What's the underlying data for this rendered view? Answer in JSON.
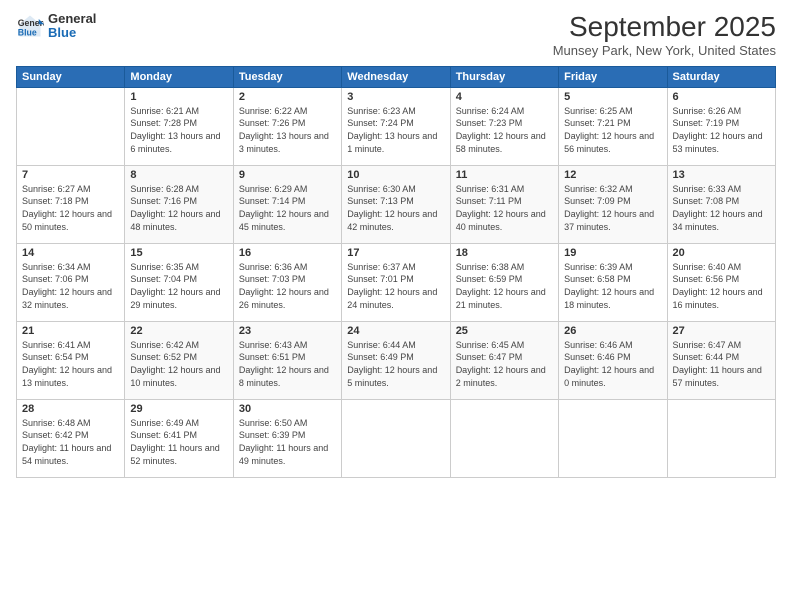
{
  "logo": {
    "line1": "General",
    "line2": "Blue"
  },
  "title": "September 2025",
  "location": "Munsey Park, New York, United States",
  "days_of_week": [
    "Sunday",
    "Monday",
    "Tuesday",
    "Wednesday",
    "Thursday",
    "Friday",
    "Saturday"
  ],
  "weeks": [
    [
      {
        "day": "",
        "sunrise": "",
        "sunset": "",
        "daylight": ""
      },
      {
        "day": "1",
        "sunrise": "Sunrise: 6:21 AM",
        "sunset": "Sunset: 7:28 PM",
        "daylight": "Daylight: 13 hours and 6 minutes."
      },
      {
        "day": "2",
        "sunrise": "Sunrise: 6:22 AM",
        "sunset": "Sunset: 7:26 PM",
        "daylight": "Daylight: 13 hours and 3 minutes."
      },
      {
        "day": "3",
        "sunrise": "Sunrise: 6:23 AM",
        "sunset": "Sunset: 7:24 PM",
        "daylight": "Daylight: 13 hours and 1 minute."
      },
      {
        "day": "4",
        "sunrise": "Sunrise: 6:24 AM",
        "sunset": "Sunset: 7:23 PM",
        "daylight": "Daylight: 12 hours and 58 minutes."
      },
      {
        "day": "5",
        "sunrise": "Sunrise: 6:25 AM",
        "sunset": "Sunset: 7:21 PM",
        "daylight": "Daylight: 12 hours and 56 minutes."
      },
      {
        "day": "6",
        "sunrise": "Sunrise: 6:26 AM",
        "sunset": "Sunset: 7:19 PM",
        "daylight": "Daylight: 12 hours and 53 minutes."
      }
    ],
    [
      {
        "day": "7",
        "sunrise": "Sunrise: 6:27 AM",
        "sunset": "Sunset: 7:18 PM",
        "daylight": "Daylight: 12 hours and 50 minutes."
      },
      {
        "day": "8",
        "sunrise": "Sunrise: 6:28 AM",
        "sunset": "Sunset: 7:16 PM",
        "daylight": "Daylight: 12 hours and 48 minutes."
      },
      {
        "day": "9",
        "sunrise": "Sunrise: 6:29 AM",
        "sunset": "Sunset: 7:14 PM",
        "daylight": "Daylight: 12 hours and 45 minutes."
      },
      {
        "day": "10",
        "sunrise": "Sunrise: 6:30 AM",
        "sunset": "Sunset: 7:13 PM",
        "daylight": "Daylight: 12 hours and 42 minutes."
      },
      {
        "day": "11",
        "sunrise": "Sunrise: 6:31 AM",
        "sunset": "Sunset: 7:11 PM",
        "daylight": "Daylight: 12 hours and 40 minutes."
      },
      {
        "day": "12",
        "sunrise": "Sunrise: 6:32 AM",
        "sunset": "Sunset: 7:09 PM",
        "daylight": "Daylight: 12 hours and 37 minutes."
      },
      {
        "day": "13",
        "sunrise": "Sunrise: 6:33 AM",
        "sunset": "Sunset: 7:08 PM",
        "daylight": "Daylight: 12 hours and 34 minutes."
      }
    ],
    [
      {
        "day": "14",
        "sunrise": "Sunrise: 6:34 AM",
        "sunset": "Sunset: 7:06 PM",
        "daylight": "Daylight: 12 hours and 32 minutes."
      },
      {
        "day": "15",
        "sunrise": "Sunrise: 6:35 AM",
        "sunset": "Sunset: 7:04 PM",
        "daylight": "Daylight: 12 hours and 29 minutes."
      },
      {
        "day": "16",
        "sunrise": "Sunrise: 6:36 AM",
        "sunset": "Sunset: 7:03 PM",
        "daylight": "Daylight: 12 hours and 26 minutes."
      },
      {
        "day": "17",
        "sunrise": "Sunrise: 6:37 AM",
        "sunset": "Sunset: 7:01 PM",
        "daylight": "Daylight: 12 hours and 24 minutes."
      },
      {
        "day": "18",
        "sunrise": "Sunrise: 6:38 AM",
        "sunset": "Sunset: 6:59 PM",
        "daylight": "Daylight: 12 hours and 21 minutes."
      },
      {
        "day": "19",
        "sunrise": "Sunrise: 6:39 AM",
        "sunset": "Sunset: 6:58 PM",
        "daylight": "Daylight: 12 hours and 18 minutes."
      },
      {
        "day": "20",
        "sunrise": "Sunrise: 6:40 AM",
        "sunset": "Sunset: 6:56 PM",
        "daylight": "Daylight: 12 hours and 16 minutes."
      }
    ],
    [
      {
        "day": "21",
        "sunrise": "Sunrise: 6:41 AM",
        "sunset": "Sunset: 6:54 PM",
        "daylight": "Daylight: 12 hours and 13 minutes."
      },
      {
        "day": "22",
        "sunrise": "Sunrise: 6:42 AM",
        "sunset": "Sunset: 6:52 PM",
        "daylight": "Daylight: 12 hours and 10 minutes."
      },
      {
        "day": "23",
        "sunrise": "Sunrise: 6:43 AM",
        "sunset": "Sunset: 6:51 PM",
        "daylight": "Daylight: 12 hours and 8 minutes."
      },
      {
        "day": "24",
        "sunrise": "Sunrise: 6:44 AM",
        "sunset": "Sunset: 6:49 PM",
        "daylight": "Daylight: 12 hours and 5 minutes."
      },
      {
        "day": "25",
        "sunrise": "Sunrise: 6:45 AM",
        "sunset": "Sunset: 6:47 PM",
        "daylight": "Daylight: 12 hours and 2 minutes."
      },
      {
        "day": "26",
        "sunrise": "Sunrise: 6:46 AM",
        "sunset": "Sunset: 6:46 PM",
        "daylight": "Daylight: 12 hours and 0 minutes."
      },
      {
        "day": "27",
        "sunrise": "Sunrise: 6:47 AM",
        "sunset": "Sunset: 6:44 PM",
        "daylight": "Daylight: 11 hours and 57 minutes."
      }
    ],
    [
      {
        "day": "28",
        "sunrise": "Sunrise: 6:48 AM",
        "sunset": "Sunset: 6:42 PM",
        "daylight": "Daylight: 11 hours and 54 minutes."
      },
      {
        "day": "29",
        "sunrise": "Sunrise: 6:49 AM",
        "sunset": "Sunset: 6:41 PM",
        "daylight": "Daylight: 11 hours and 52 minutes."
      },
      {
        "day": "30",
        "sunrise": "Sunrise: 6:50 AM",
        "sunset": "Sunset: 6:39 PM",
        "daylight": "Daylight: 11 hours and 49 minutes."
      },
      {
        "day": "",
        "sunrise": "",
        "sunset": "",
        "daylight": ""
      },
      {
        "day": "",
        "sunrise": "",
        "sunset": "",
        "daylight": ""
      },
      {
        "day": "",
        "sunrise": "",
        "sunset": "",
        "daylight": ""
      },
      {
        "day": "",
        "sunrise": "",
        "sunset": "",
        "daylight": ""
      }
    ]
  ]
}
